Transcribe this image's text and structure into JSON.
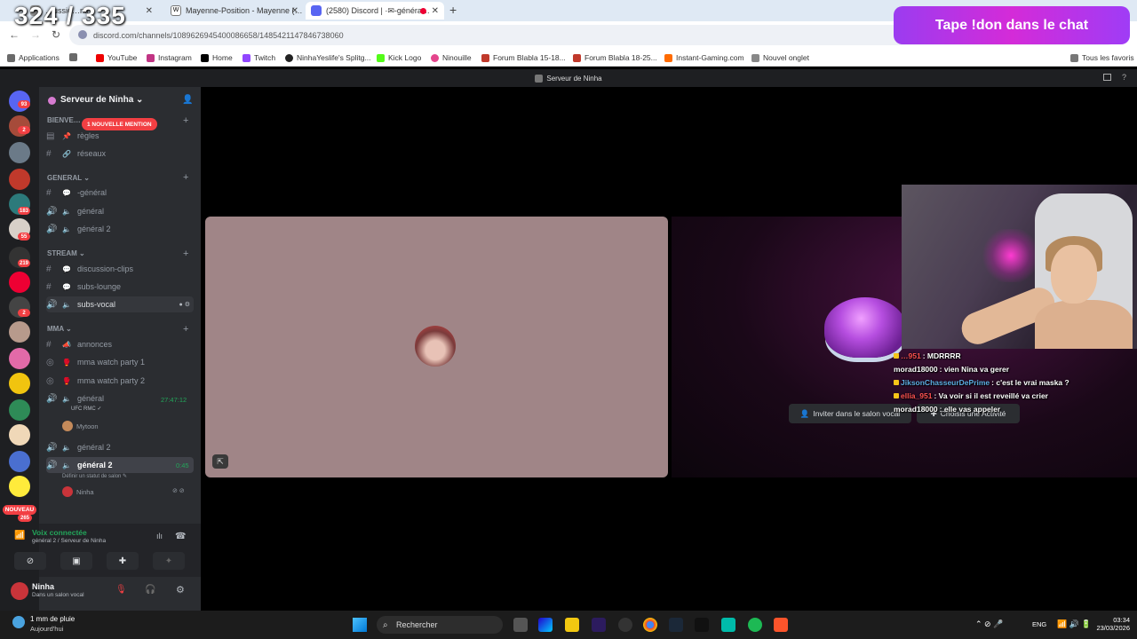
{
  "browser": {
    "tabs": [
      {
        "label": "…ussie…ns",
        "active": false
      },
      {
        "label": "Mayenne-Position - Mayenne (…",
        "active": false
      },
      {
        "label": "(2580) Discord | ·✉-généra…",
        "active": true
      }
    ],
    "url": "discord.com/channels/1089626945400086658/1485421147846738060",
    "bookmarks": [
      "Applications",
      "YouTube",
      "Instagram",
      "Home",
      "Twitch",
      "NinhaYeslife's Splitg...",
      "Kick Logo",
      "Ninouille",
      "Forum Blabla 15-18...",
      "Forum Blabla 18-25...",
      "Instant-Gaming.com",
      "Nouvel onglet"
    ],
    "bookmarks_right": "Tous les favoris"
  },
  "overlay": {
    "counter": "324 / 335",
    "banner": "Tape !don dans le chat"
  },
  "discord": {
    "window_title": "Serveur de Ninha",
    "server_name": "Serveur de Ninha",
    "mention_pill": "1 NOUVELLE MENTION",
    "bienvenue": "BIENVE…",
    "rail_badges": [
      "93",
      "2",
      "183",
      "55",
      "219",
      "2",
      "265"
    ],
    "nouveau": "NOUVEAU",
    "categories": {
      "general": "GENERAL",
      "stream": "STREAM",
      "mma": "MMA"
    },
    "channels": {
      "regles": "règles",
      "reseaux": "réseaux",
      "general_text": "-général",
      "general_voice": "général",
      "general2_voice": "général 2",
      "discussion_clips": "discussion-clips",
      "subs_lounge": "subs-lounge",
      "subs_vocal": "subs-vocal",
      "annonces": "annonces",
      "mma_party1": "mma watch party 1",
      "mma_party2": "mma watch party 2",
      "mma_general": "général",
      "mma_general_timer": "27:47:12",
      "mma_general_tag": "UFC RMC",
      "mma_general_user": "Mytoon",
      "mma_general2a": "général 2",
      "mma_general2b": "général 2",
      "mma_general2b_timer": "0:45",
      "status_prompt": "Définir un statut de salon",
      "mma_general2b_user": "Ninha"
    },
    "voice": {
      "title": "Voix connectée",
      "subtitle": "général 2 / Serveur de Ninha"
    },
    "me": {
      "name": "Ninha",
      "status": "Dans un salon vocal"
    },
    "stage": {
      "invite": "Inviter dans le salon vocal",
      "activity": "Choisis une Activité"
    }
  },
  "chat": [
    {
      "user": "…951",
      "msg": ": MDRRRR"
    },
    {
      "user": "morad18000",
      "msg": ": vien Nina va gerer"
    },
    {
      "user": "JiksonChasseurDePrime",
      "msg": ": c'est le vrai maska ?"
    },
    {
      "user": "ellia_951",
      "msg": ": Va voir si il est reveillé va crier"
    },
    {
      "user": "morad18000",
      "msg": ": elle vas appeler"
    }
  ],
  "taskbar": {
    "weather": "1 mm de pluie",
    "weather_sub": "Aujourd'hui",
    "search": "Rechercher",
    "lang": "ENG",
    "time": "03:34",
    "date": "23/03/2026"
  },
  "colors": {
    "discord_bg": "#2b2d31",
    "rail_bg": "#1e1f22",
    "accent_green": "#23a55a",
    "mention_red": "#f23f43",
    "banner": "#c92bd8"
  }
}
